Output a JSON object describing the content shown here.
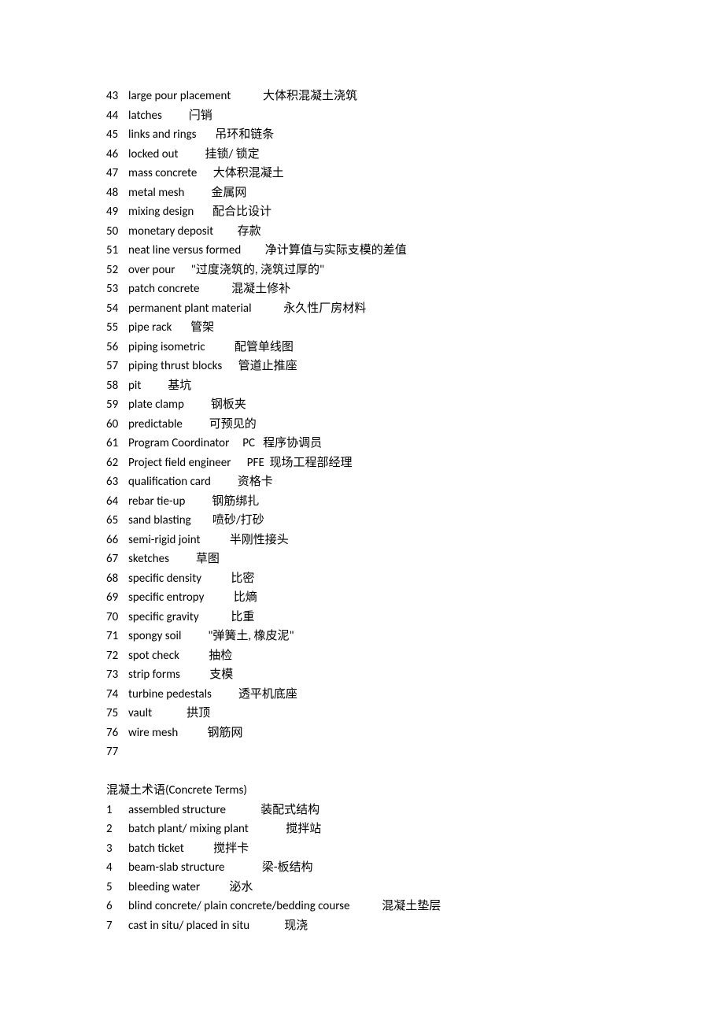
{
  "list1": [
    {
      "n": "43",
      "text": "large pour placement            大体积混凝土浇筑"
    },
    {
      "n": "44",
      "text": "latches          闩销"
    },
    {
      "n": "45",
      "text": "links and rings       吊环和链条"
    },
    {
      "n": "46",
      "text": "locked out          挂锁/ 锁定"
    },
    {
      "n": "47",
      "text": "mass concrete      大体积混凝土"
    },
    {
      "n": "48",
      "text": "metal mesh          金属网"
    },
    {
      "n": "49",
      "text": "mixing design       配合比设计"
    },
    {
      "n": "50",
      "text": "monetary deposit         存款"
    },
    {
      "n": "51",
      "text": "neat line versus formed         净计算值与实际支模的差值"
    },
    {
      "n": "52",
      "text": "over pour      \"过度浇筑的, 浇筑过厚的\""
    },
    {
      "n": "53",
      "text": "patch concrete            混凝土修补"
    },
    {
      "n": "54",
      "text": "permanent plant material            永久性厂房材料"
    },
    {
      "n": "55",
      "text": "pipe rack       管架"
    },
    {
      "n": "56",
      "text": "piping isometric           配管单线图"
    },
    {
      "n": "57",
      "text": "piping thrust blocks      管道止推座"
    },
    {
      "n": "58",
      "text": "pit          基坑"
    },
    {
      "n": "59",
      "text": "plate clamp          钢板夹"
    },
    {
      "n": "60",
      "text": "predictable          可预见的"
    },
    {
      "n": "61",
      "text": "Program Coordinator     PC   程序协调员"
    },
    {
      "n": "62",
      "text": "Project field engineer      PFE  现场工程部经理"
    },
    {
      "n": "63",
      "text": "qualification card          资格卡"
    },
    {
      "n": "64",
      "text": "rebar tie-up          钢筋绑扎"
    },
    {
      "n": "65",
      "text": "sand blasting        喷砂/打砂"
    },
    {
      "n": "66",
      "text": "semi-rigid joint           半刚性接头"
    },
    {
      "n": "67",
      "text": "sketches          草图"
    },
    {
      "n": "68",
      "text": "specific density           比密"
    },
    {
      "n": "69",
      "text": "specific entropy           比熵"
    },
    {
      "n": "70",
      "text": "specific gravity            比重"
    },
    {
      "n": "71",
      "text": "spongy soil          \"弹簧土, 橡皮泥\""
    },
    {
      "n": "72",
      "text": "spot check           抽检"
    },
    {
      "n": "73",
      "text": "strip forms           支模"
    },
    {
      "n": "74",
      "text": "turbine pedestals          透平机底座"
    },
    {
      "n": "75",
      "text": "vault             拱顶"
    },
    {
      "n": "76",
      "text": "wire mesh           钢筋网"
    },
    {
      "n": "77",
      "text": ""
    }
  ],
  "section_title": "混凝土术语(Concrete Terms)",
  "list2": [
    {
      "n": "1",
      "text": "assembled structure             装配式结构"
    },
    {
      "n": "2",
      "text": "batch plant/ mixing plant              搅拌站"
    },
    {
      "n": "3",
      "text": "batch ticket           搅拌卡"
    },
    {
      "n": "4",
      "text": "beam-slab structure              梁-板结构"
    },
    {
      "n": "5",
      "text": "bleeding water           泌水"
    },
    {
      "n": "6",
      "text": "blind concrete/ plain concrete/bedding course            混凝土垫层"
    },
    {
      "n": "7",
      "text": "cast in situ/ placed in situ             现浇"
    }
  ]
}
